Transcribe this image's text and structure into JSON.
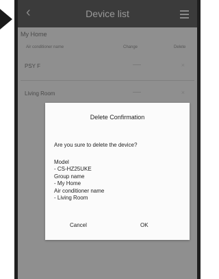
{
  "header": {
    "title": "Device list",
    "back_icon": "chevron-left-icon",
    "menu_icon": "hamburger-menu-icon"
  },
  "group": {
    "name": "My Home",
    "columns": {
      "name": "Air conditioner name",
      "change": "Change",
      "delete": "Delete"
    }
  },
  "devices": [
    {
      "name": "PSY F"
    },
    {
      "name": "Living Room"
    }
  ],
  "dialog": {
    "title": "Delete Confirmation",
    "question": "Are you sure to delete the device?",
    "model_label": "Model",
    "model_value": "- CS-HZ25UKE",
    "group_label": "Group name",
    "group_value": "- My Home",
    "ac_label": "Air conditioner name",
    "ac_value": "- Living Room",
    "cancel_label": "Cancel",
    "ok_label": "OK"
  }
}
